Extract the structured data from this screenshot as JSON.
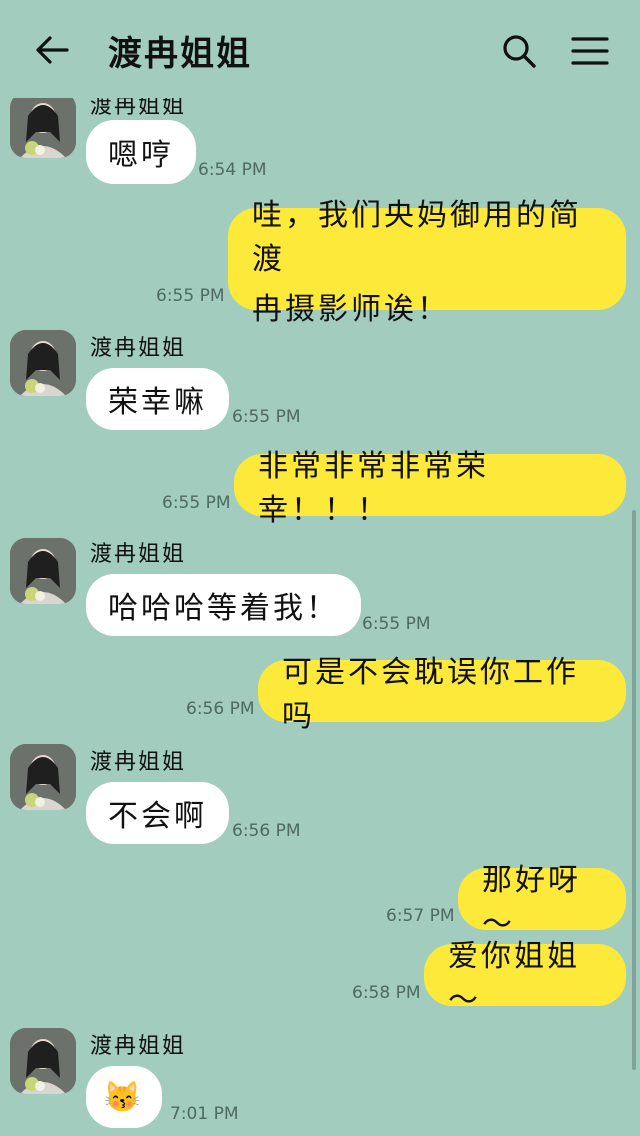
{
  "header": {
    "title": "渡冉姐姐",
    "back_icon": "arrow-left-icon",
    "search_icon": "search-icon",
    "menu_icon": "menu-icon"
  },
  "colors": {
    "background": "#a1ccbe",
    "incoming_bubble": "#ffffff",
    "outgoing_bubble": "#fde93a"
  },
  "messages": [
    {
      "direction": "in",
      "sender": "渡冉姐姐",
      "text": "嗯哼",
      "time": "6:54 PM"
    },
    {
      "direction": "out",
      "text_line1": "哇，我们央妈御用的简渡",
      "text_line2": "冉摄影师诶！",
      "time": "6:55 PM"
    },
    {
      "direction": "in",
      "sender": "渡冉姐姐",
      "text": "荣幸嘛",
      "time": "6:55 PM"
    },
    {
      "direction": "out",
      "text": "非常非常非常荣幸！！！",
      "time": "6:55 PM"
    },
    {
      "direction": "in",
      "sender": "渡冉姐姐",
      "text": "哈哈哈等着我！",
      "time": "6:55 PM"
    },
    {
      "direction": "out",
      "text": "可是不会耽误你工作吗",
      "time": "6:56 PM"
    },
    {
      "direction": "in",
      "sender": "渡冉姐姐",
      "text": "不会啊",
      "time": "6:56 PM"
    },
    {
      "direction": "out",
      "text": "那好呀～",
      "time": "6:57 PM"
    },
    {
      "direction": "out",
      "text": "爱你姐姐～",
      "time": "6:58 PM"
    },
    {
      "direction": "in",
      "sender": "渡冉姐姐",
      "text": "😽",
      "time": "7:01 PM"
    }
  ]
}
